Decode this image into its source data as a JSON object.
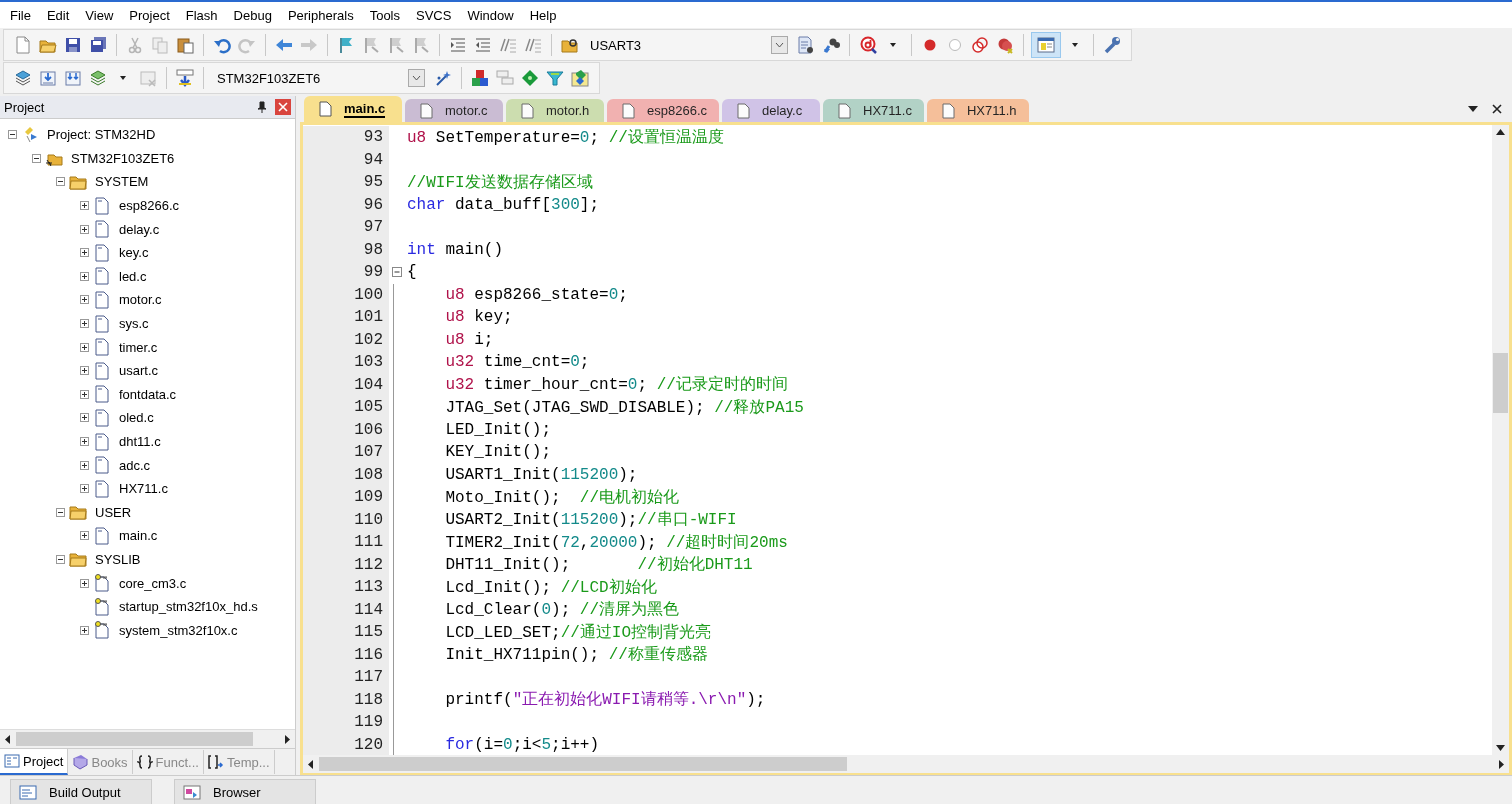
{
  "menu": [
    "File",
    "Edit",
    "View",
    "Project",
    "Flash",
    "Debug",
    "Peripherals",
    "Tools",
    "SVCS",
    "Window",
    "Help"
  ],
  "toolbar": {
    "find_combo": "USART3",
    "target_combo": "STM32F103ZET6"
  },
  "project_panel": {
    "title": "Project",
    "tree": [
      {
        "label": "Project: STM32HD",
        "kind": "project",
        "expanded": true,
        "children": [
          {
            "label": "STM32F103ZET6",
            "kind": "target",
            "expanded": true,
            "children": [
              {
                "label": "SYSTEM",
                "kind": "group",
                "expanded": true,
                "children": [
                  {
                    "label": "esp8266.c",
                    "kind": "file",
                    "expanded": false
                  },
                  {
                    "label": "delay.c",
                    "kind": "file",
                    "expanded": false
                  },
                  {
                    "label": "key.c",
                    "kind": "file",
                    "expanded": false
                  },
                  {
                    "label": "led.c",
                    "kind": "file",
                    "expanded": false
                  },
                  {
                    "label": "motor.c",
                    "kind": "file",
                    "expanded": false
                  },
                  {
                    "label": "sys.c",
                    "kind": "file",
                    "expanded": false
                  },
                  {
                    "label": "timer.c",
                    "kind": "file",
                    "expanded": false
                  },
                  {
                    "label": "usart.c",
                    "kind": "file",
                    "expanded": false
                  },
                  {
                    "label": "fontdata.c",
                    "kind": "file",
                    "expanded": false
                  },
                  {
                    "label": "oled.c",
                    "kind": "file",
                    "expanded": false
                  },
                  {
                    "label": "dht11.c",
                    "kind": "file",
                    "expanded": false
                  },
                  {
                    "label": "adc.c",
                    "kind": "file",
                    "expanded": false
                  },
                  {
                    "label": "HX711.c",
                    "kind": "file",
                    "expanded": false
                  }
                ]
              },
              {
                "label": "USER",
                "kind": "group",
                "expanded": true,
                "children": [
                  {
                    "label": "main.c",
                    "kind": "file",
                    "expanded": false
                  }
                ]
              },
              {
                "label": "SYSLIB",
                "kind": "group",
                "expanded": true,
                "children": [
                  {
                    "label": "core_cm3.c",
                    "kind": "lib-file",
                    "expanded": false
                  },
                  {
                    "label": "startup_stm32f10x_hd.s",
                    "kind": "lib-leaf"
                  },
                  {
                    "label": "system_stm32f10x.c",
                    "kind": "lib-file",
                    "expanded": false
                  }
                ]
              }
            ]
          }
        ]
      }
    ],
    "tabs": [
      {
        "label": "Project",
        "kind": "project",
        "selected": true
      },
      {
        "label": "Books",
        "kind": "books",
        "selected": false
      },
      {
        "label": "Funct...",
        "kind": "functions",
        "selected": false
      },
      {
        "label": "Temp...",
        "kind": "templates",
        "selected": false
      }
    ]
  },
  "editor_tabs": [
    {
      "label": "main.c",
      "selected": true,
      "color": "#f8e08e"
    },
    {
      "label": "motor.c",
      "selected": false,
      "color": "#c4b4cf"
    },
    {
      "label": "motor.h",
      "selected": false,
      "color": "#c6daa4"
    },
    {
      "label": "esp8266.c",
      "selected": false,
      "color": "#f2a7a6"
    },
    {
      "label": "delay.c",
      "selected": false,
      "color": "#cbbce6"
    },
    {
      "label": "HX711.c",
      "selected": false,
      "color": "#a8cdbf"
    },
    {
      "label": "HX711.h",
      "selected": false,
      "color": "#f6b78c"
    }
  ],
  "code": [
    {
      "number": "93",
      "kind": "code",
      "tokens": [
        {
          "kind": "type",
          "text": "u8"
        },
        {
          "kind": "plain",
          "text": " SetTemperature="
        },
        {
          "kind": "num",
          "text": "0"
        },
        {
          "kind": "plain",
          "text": "; "
        },
        {
          "kind": "comment",
          "text": "//设置恒温温度"
        }
      ]
    },
    {
      "number": "94",
      "kind": "code"
    },
    {
      "number": "95",
      "kind": "code",
      "tokens": [
        {
          "kind": "comment",
          "text": "//WIFI发送数据存储区域"
        }
      ]
    },
    {
      "number": "96",
      "kind": "code",
      "tokens": [
        {
          "kind": "keyword",
          "text": "char"
        },
        {
          "kind": "plain",
          "text": " data_buff["
        },
        {
          "kind": "num",
          "text": "300"
        },
        {
          "kind": "plain",
          "text": "];"
        }
      ]
    },
    {
      "number": "97",
      "kind": "code"
    },
    {
      "number": "98",
      "kind": "code",
      "tokens": [
        {
          "kind": "keyword",
          "text": "int"
        },
        {
          "kind": "plain",
          "text": " main()"
        }
      ]
    },
    {
      "number": "99",
      "kind": "fold-start",
      "tokens": [
        {
          "kind": "plain",
          "text": "{"
        }
      ]
    },
    {
      "number": "100",
      "kind": "code",
      "tokens": [
        {
          "kind": "type",
          "text": "    u8"
        },
        {
          "kind": "plain",
          "text": " esp8266_state="
        },
        {
          "kind": "num",
          "text": "0"
        },
        {
          "kind": "plain",
          "text": ";"
        }
      ]
    },
    {
      "number": "101",
      "kind": "code",
      "tokens": [
        {
          "kind": "type",
          "text": "    u8"
        },
        {
          "kind": "plain",
          "text": " key;"
        }
      ]
    },
    {
      "number": "102",
      "kind": "code",
      "tokens": [
        {
          "kind": "type",
          "text": "    u8"
        },
        {
          "kind": "plain",
          "text": " i;"
        }
      ]
    },
    {
      "number": "103",
      "kind": "code",
      "tokens": [
        {
          "kind": "type",
          "text": "    u32"
        },
        {
          "kind": "plain",
          "text": " time_cnt="
        },
        {
          "kind": "num",
          "text": "0"
        },
        {
          "kind": "plain",
          "text": ";"
        }
      ]
    },
    {
      "number": "104",
      "kind": "code",
      "tokens": [
        {
          "kind": "type",
          "text": "    u32"
        },
        {
          "kind": "plain",
          "text": " timer_hour_cnt="
        },
        {
          "kind": "num",
          "text": "0"
        },
        {
          "kind": "plain",
          "text": "; "
        },
        {
          "kind": "comment",
          "text": "//记录定时的时间"
        }
      ]
    },
    {
      "number": "105",
      "kind": "code",
      "tokens": [
        {
          "kind": "plain",
          "text": "    JTAG_Set(JTAG_SWD_DISABLE); "
        },
        {
          "kind": "comment",
          "text": "//释放PA15"
        }
      ]
    },
    {
      "number": "106",
      "kind": "code",
      "tokens": [
        {
          "kind": "plain",
          "text": "    LED_Init();"
        }
      ]
    },
    {
      "number": "107",
      "kind": "code",
      "tokens": [
        {
          "kind": "plain",
          "text": "    KEY_Init();"
        }
      ]
    },
    {
      "number": "108",
      "kind": "code",
      "tokens": [
        {
          "kind": "plain",
          "text": "    USART1_Init("
        },
        {
          "kind": "num",
          "text": "115200"
        },
        {
          "kind": "plain",
          "text": ");"
        }
      ]
    },
    {
      "number": "109",
      "kind": "code",
      "tokens": [
        {
          "kind": "plain",
          "text": "    Moto_Init();  "
        },
        {
          "kind": "comment",
          "text": "//电机初始化"
        }
      ]
    },
    {
      "number": "110",
      "kind": "code",
      "tokens": [
        {
          "kind": "plain",
          "text": "    USART2_Init("
        },
        {
          "kind": "num",
          "text": "115200"
        },
        {
          "kind": "plain",
          "text": ");"
        },
        {
          "kind": "comment",
          "text": "//串口-WIFI"
        }
      ]
    },
    {
      "number": "111",
      "kind": "code",
      "tokens": [
        {
          "kind": "plain",
          "text": "    TIMER2_Init("
        },
        {
          "kind": "num",
          "text": "72"
        },
        {
          "kind": "plain",
          "text": ","
        },
        {
          "kind": "num",
          "text": "20000"
        },
        {
          "kind": "plain",
          "text": "); "
        },
        {
          "kind": "comment",
          "text": "//超时时间20ms"
        }
      ]
    },
    {
      "number": "112",
      "kind": "code",
      "tokens": [
        {
          "kind": "plain",
          "text": "    DHT11_Init();       "
        },
        {
          "kind": "comment",
          "text": "//初始化DHT11"
        }
      ]
    },
    {
      "number": "113",
      "kind": "code",
      "tokens": [
        {
          "kind": "plain",
          "text": "    Lcd_Init(); "
        },
        {
          "kind": "comment",
          "text": "//LCD初始化"
        }
      ]
    },
    {
      "number": "114",
      "kind": "code",
      "tokens": [
        {
          "kind": "plain",
          "text": "    Lcd_Clear("
        },
        {
          "kind": "num",
          "text": "0"
        },
        {
          "kind": "plain",
          "text": "); "
        },
        {
          "kind": "comment",
          "text": "//清屏为黑色"
        }
      ]
    },
    {
      "number": "115",
      "kind": "code",
      "tokens": [
        {
          "kind": "plain",
          "text": "    LCD_LED_SET;"
        },
        {
          "kind": "comment",
          "text": "//通过IO控制背光亮"
        }
      ]
    },
    {
      "number": "116",
      "kind": "code",
      "tokens": [
        {
          "kind": "plain",
          "text": "    Init_HX711pin(); "
        },
        {
          "kind": "comment",
          "text": "//称重传感器"
        }
      ]
    },
    {
      "number": "117",
      "kind": "code"
    },
    {
      "number": "118",
      "kind": "code",
      "tokens": [
        {
          "kind": "plain",
          "text": "    printf("
        },
        {
          "kind": "string",
          "text": "\"正在初始化WIFI请稍等.\\r\\n\""
        },
        {
          "kind": "plain",
          "text": ");"
        }
      ]
    },
    {
      "number": "119",
      "kind": "code"
    },
    {
      "number": "120",
      "kind": "code",
      "tokens": [
        {
          "kind": "keyword",
          "text": "    for"
        },
        {
          "kind": "plain",
          "text": "(i="
        },
        {
          "kind": "num",
          "text": "0"
        },
        {
          "kind": "plain",
          "text": ";i<"
        },
        {
          "kind": "num",
          "text": "5"
        },
        {
          "kind": "plain",
          "text": ";i++)"
        }
      ]
    }
  ],
  "bottom_tabs": [
    {
      "label": "Build Output",
      "kind": "build",
      "selected": false
    },
    {
      "label": "Browser",
      "kind": "browser",
      "selected": false
    }
  ]
}
